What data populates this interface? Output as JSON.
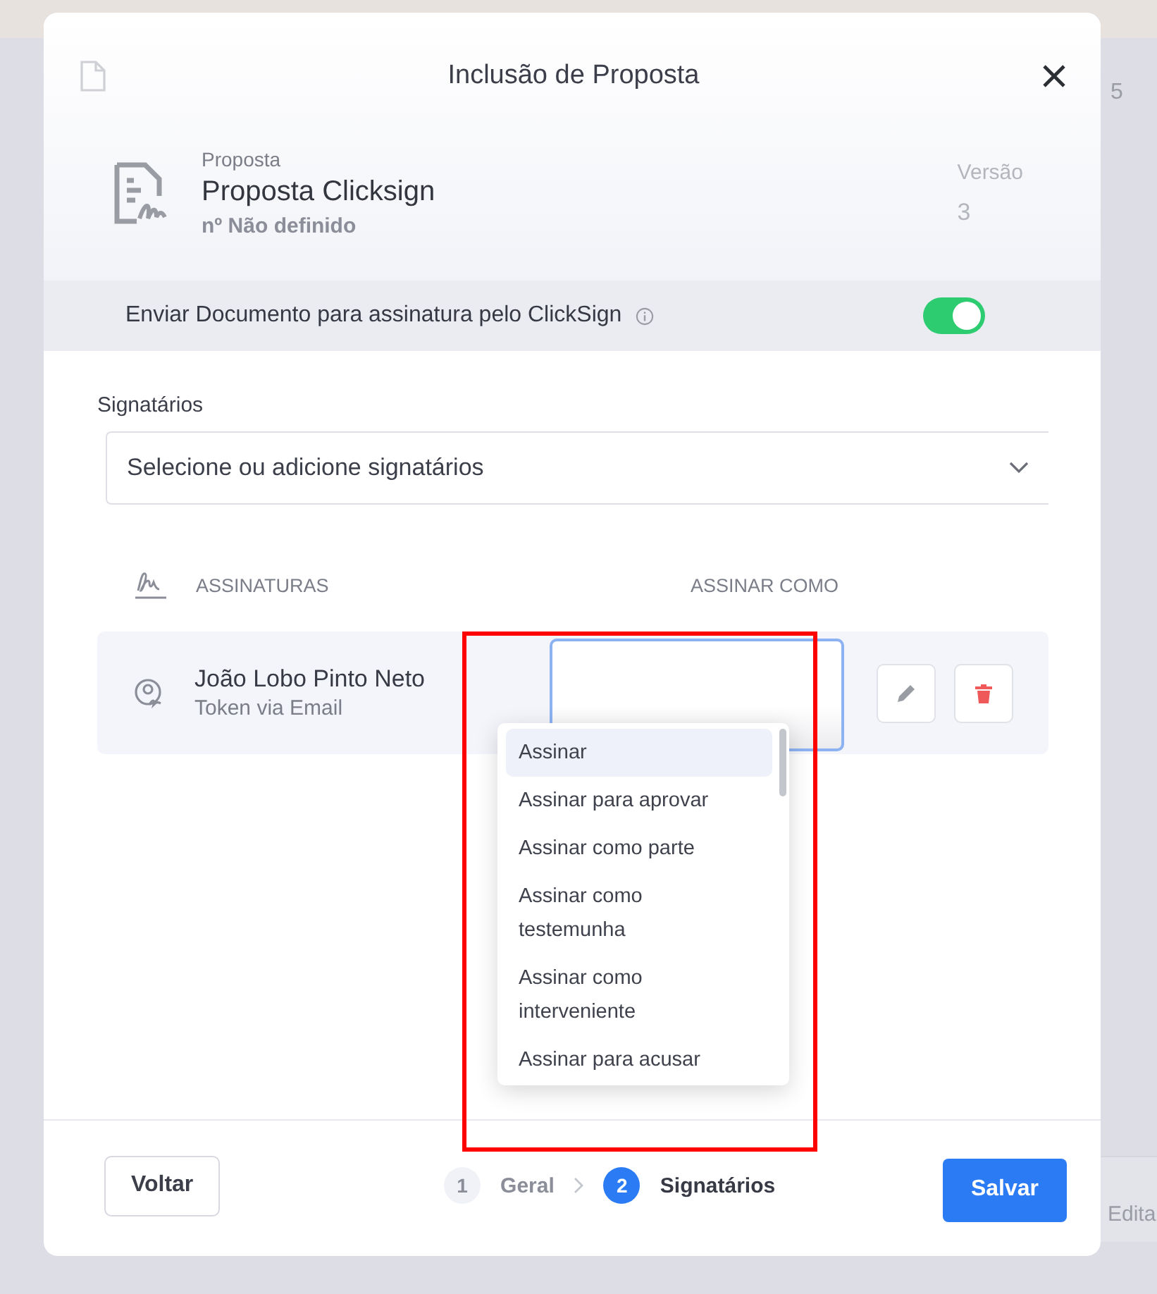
{
  "background": {
    "count": "5",
    "action": "Edita"
  },
  "dialog": {
    "title": "Inclusão de Proposta"
  },
  "document": {
    "label": "Proposta",
    "name": "Proposta Clicksign",
    "number": "nº Não definido",
    "version_label": "Versão",
    "version": "3"
  },
  "clicksign": {
    "label": "Enviar Documento para assinatura pelo ClickSign",
    "on": true
  },
  "signers_field": {
    "label": "Signatários",
    "placeholder": "Selecione ou adicione signatários"
  },
  "table": {
    "columns": [
      "ASSINATURAS",
      "ASSINAR COMO"
    ],
    "rows": [
      {
        "name": "João Lobo Pinto Neto",
        "method": "Token via Email"
      }
    ]
  },
  "sign_as_dropdown": {
    "expanded": true,
    "options": [
      {
        "label": "Assinar",
        "selected": true
      },
      {
        "label": "Assinar para aprovar",
        "selected": false
      },
      {
        "label": "Assinar como parte",
        "selected": false
      },
      {
        "label": "Assinar como testemunha",
        "selected": false
      },
      {
        "label": "Assinar como interveniente",
        "selected": false
      },
      {
        "label": "Assinar para acusar",
        "selected": false
      }
    ]
  },
  "footer": {
    "back": "Voltar",
    "steps": [
      {
        "number": "1",
        "label": "Geral",
        "selected": false
      },
      {
        "number": "2",
        "label": "Signatários",
        "selected": true
      }
    ],
    "save": "Salvar"
  }
}
